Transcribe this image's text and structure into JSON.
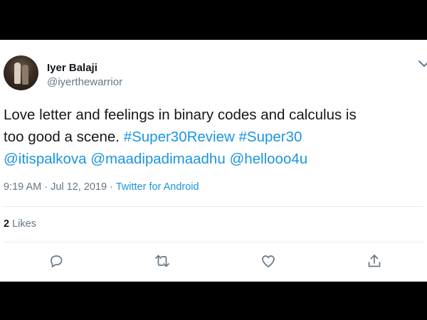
{
  "tweet": {
    "display_name": "Iyer Balaji",
    "handle": "@iyerthewarrior",
    "text_line1": "Love letter and feelings in  binary codes and calculus is",
    "text_line2_plain": "too good a scene. ",
    "hashtag1": "#Super30Review",
    "hashtag2": "#Super30",
    "mention1": "@itispalkova",
    "mention2": "@maadipadimaadhu",
    "mention3": "@hellooo4u",
    "time": "9:19 AM",
    "date": "Jul 12, 2019",
    "separator": " · ",
    "source": "Twitter for Android",
    "likes_count": "2",
    "likes_label": "Likes"
  },
  "icons": {
    "more": "chevron-down-icon",
    "reply": "reply-icon",
    "retweet": "retweet-icon",
    "like": "heart-icon",
    "share": "share-icon"
  },
  "colors": {
    "link": "#1b95e0",
    "text": "#14171a",
    "muted": "#657786",
    "divider": "#e6ecf0",
    "letterbox": "#000000"
  }
}
